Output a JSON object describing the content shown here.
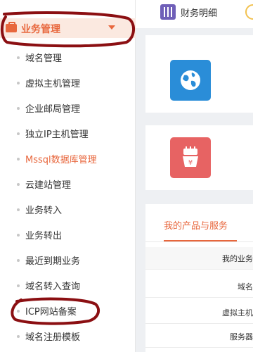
{
  "sidebar": {
    "section_title": "业务管理",
    "items": [
      {
        "label": "域名管理"
      },
      {
        "label": "虚拟主机管理"
      },
      {
        "label": "企业邮局管理"
      },
      {
        "label": "独立IP主机管理"
      },
      {
        "label": "Mssql数据库管理"
      },
      {
        "label": "云建站管理"
      },
      {
        "label": "业务转入"
      },
      {
        "label": "业务转出"
      },
      {
        "label": "最近到期业务"
      },
      {
        "label": "域名转入查询"
      },
      {
        "label": "ICP网站备案"
      },
      {
        "label": "域名注册模板"
      }
    ],
    "active_index": 4
  },
  "topbar": {
    "finance_label": "财务明细"
  },
  "products": {
    "tab_label": "我的产品与服务",
    "rows": [
      {
        "text": "我的业务"
      },
      {
        "text": "域名"
      },
      {
        "text": "虚拟主机"
      },
      {
        "text": "服务器"
      }
    ]
  },
  "colors": {
    "accent": "#e8673d",
    "annotation": "#8b0f12",
    "globe_tile": "#2a8dd8",
    "ssl_tile": "#e76363"
  },
  "icons": {
    "section": "briefcase-icon",
    "finance": "sliders-icon",
    "globe": "globe-icon",
    "ssl": "certificate-icon"
  }
}
